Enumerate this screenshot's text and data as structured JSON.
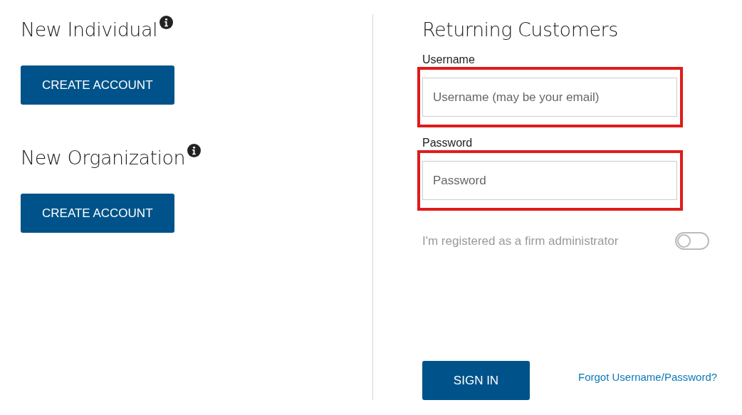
{
  "new_accounts": [
    {
      "heading": "New Individual",
      "button": "CREATE ACCOUNT"
    },
    {
      "heading": "New Organization",
      "button": "CREATE ACCOUNT"
    }
  ],
  "returning": {
    "heading": "Returning Customers",
    "fields": [
      {
        "label": "Username",
        "placeholder": "Username (may be your email)",
        "highlighted": true
      },
      {
        "label": "Password",
        "placeholder": "Password",
        "highlighted": true
      }
    ],
    "admin_toggle": {
      "label": "I'm registered as a firm administrator",
      "on": false
    },
    "sign_in": "SIGN IN",
    "forgot_link": "Forgot Username/Password?"
  }
}
